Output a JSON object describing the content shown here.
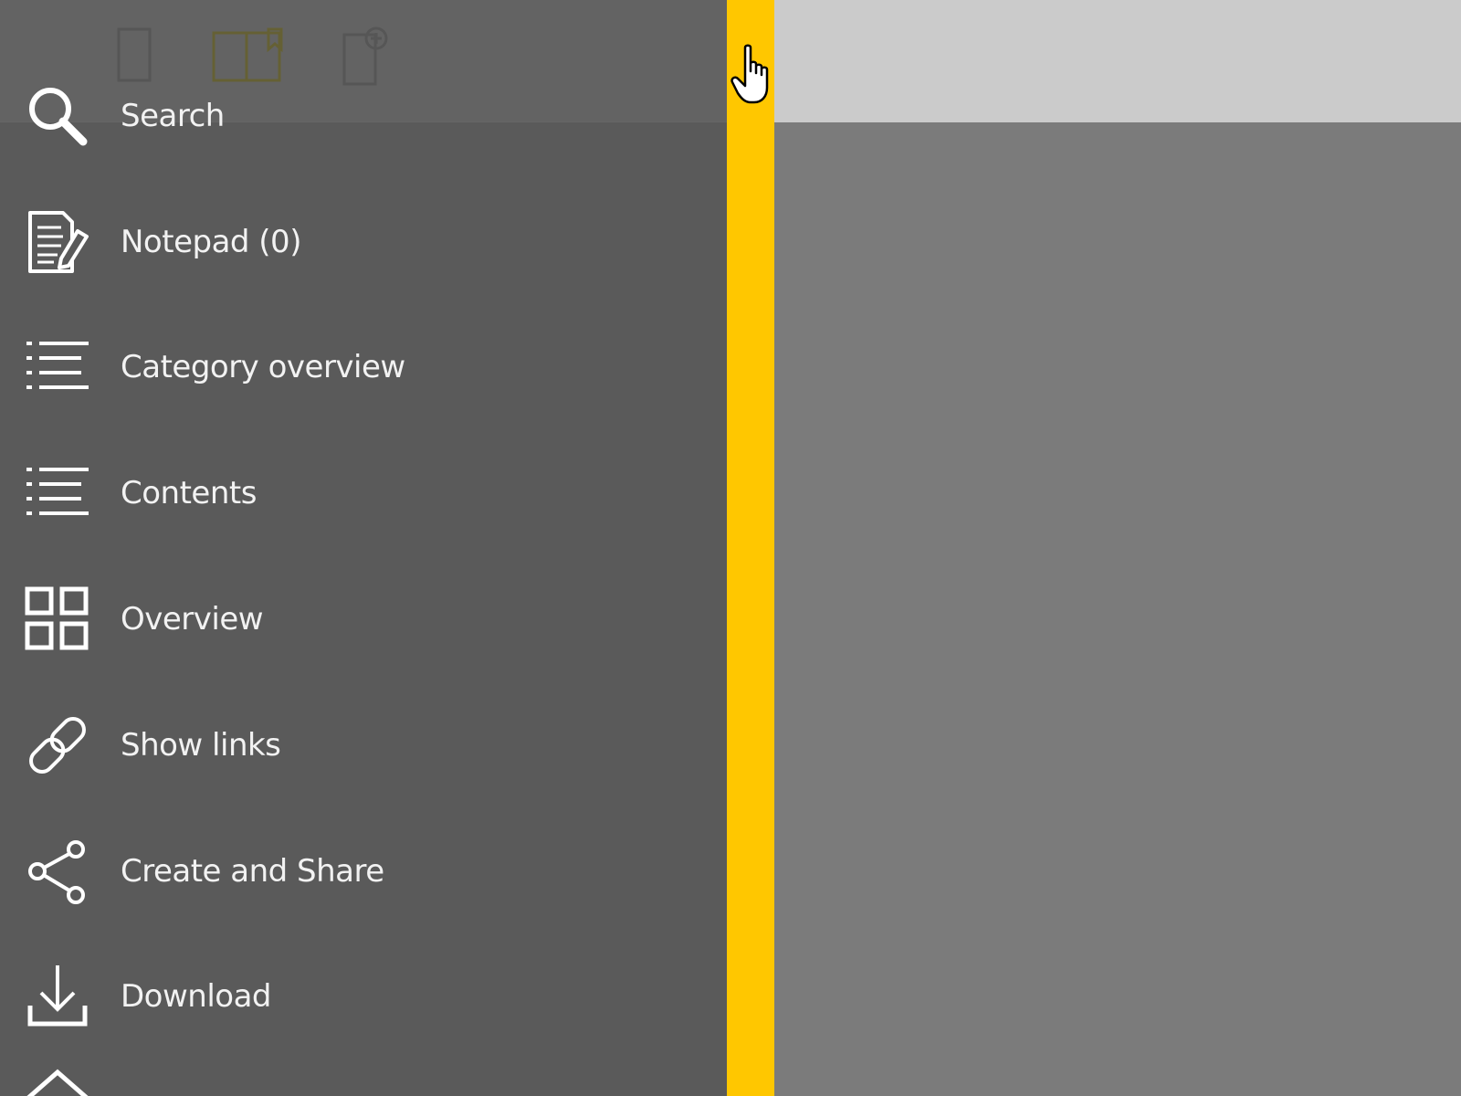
{
  "colors": {
    "menu_background": "#5a5a5a",
    "menu_text": "#f2f2f2",
    "splitter_accent": "#ffc700",
    "content_background": "#7b7b7b",
    "content_header": "#cbcbcb"
  },
  "toolbar": {
    "icons": [
      "single-page-view-icon",
      "double-page-view-icon",
      "add-bookmark-icon"
    ]
  },
  "menu": {
    "items": [
      {
        "label": "Search",
        "icon": "search-icon"
      },
      {
        "label": "Notepad (0)",
        "icon": "notepad-icon"
      },
      {
        "label": "Category overview",
        "icon": "list-icon"
      },
      {
        "label": "Contents",
        "icon": "list-icon"
      },
      {
        "label": "Overview",
        "icon": "grid-icon"
      },
      {
        "label": "Show links",
        "icon": "link-icon"
      },
      {
        "label": "Create and Share",
        "icon": "share-icon"
      },
      {
        "label": "Download",
        "icon": "download-icon"
      },
      {
        "label": "",
        "icon": "home-icon"
      }
    ]
  }
}
